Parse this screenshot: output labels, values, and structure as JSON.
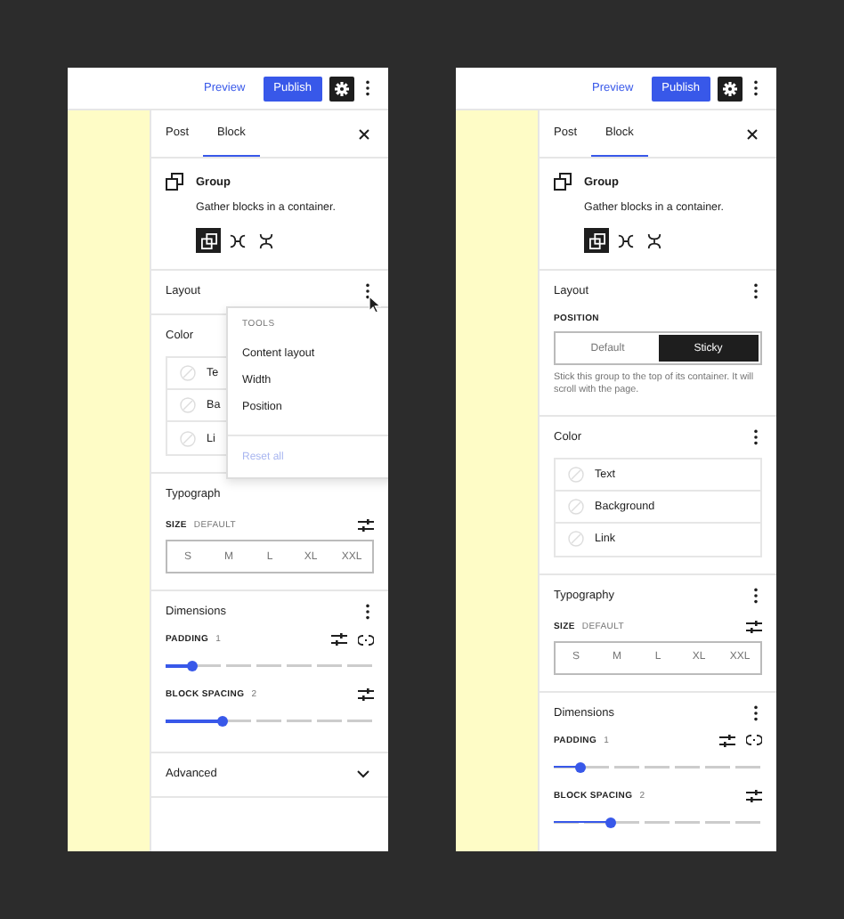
{
  "panels": [
    {
      "topbar": {
        "preview": "Preview",
        "publish": "Publish"
      },
      "tabs": [
        {
          "label": "Post",
          "selected": false
        },
        {
          "label": "Block",
          "selected": true
        }
      ],
      "block": {
        "title": "Group",
        "description": "Gather blocks in a container.",
        "variations": [
          {
            "kind": "group",
            "selected": true
          },
          {
            "kind": "row",
            "selected": false
          },
          {
            "kind": "stack",
            "selected": false
          }
        ]
      },
      "sections": [
        {
          "kind": "layout",
          "title": "Layout",
          "options_button": true,
          "menu": {
            "heading": "TOOLS",
            "items": [
              "Content layout",
              "Width",
              "Position"
            ],
            "reset": "Reset all"
          }
        },
        {
          "kind": "color",
          "title": "Color",
          "items": [
            "Te",
            "Ba",
            "Li"
          ]
        },
        {
          "kind": "typography",
          "title": "Typograph",
          "size_label": "SIZE",
          "size_value": "DEFAULT",
          "sizes": [
            {
              "label": "S",
              "selected": false
            },
            {
              "label": "M",
              "selected": false
            },
            {
              "label": "L",
              "selected": false
            },
            {
              "label": "XL",
              "selected": false
            },
            {
              "label": "XXL",
              "selected": false
            }
          ]
        },
        {
          "kind": "dimensions",
          "title": "Dimensions",
          "options_button": true,
          "controls": [
            {
              "label": "PADDING",
              "value": "1",
              "link_button": true,
              "level": 0.13
            },
            {
              "label": "BLOCK SPACING",
              "value": "2",
              "link_button": false,
              "level": 0.27
            }
          ]
        },
        {
          "kind": "advanced",
          "title": "Advanced",
          "expanded": false
        }
      ]
    },
    {
      "topbar": {
        "preview": "Preview",
        "publish": "Publish"
      },
      "tabs": [
        {
          "label": "Post",
          "selected": false
        },
        {
          "label": "Block",
          "selected": true
        }
      ],
      "block": {
        "title": "Group",
        "description": "Gather blocks in a container.",
        "variations": [
          {
            "kind": "group",
            "selected": true
          },
          {
            "kind": "row",
            "selected": false
          },
          {
            "kind": "stack",
            "selected": false
          }
        ]
      },
      "sections": [
        {
          "kind": "layout",
          "title": "Layout",
          "options_button": true,
          "position": {
            "label": "POSITION",
            "options": [
              {
                "label": "Default",
                "selected": false
              },
              {
                "label": "Sticky",
                "selected": true
              }
            ],
            "help": "Stick this group to the top of its container. It will scroll with the page."
          }
        },
        {
          "kind": "color",
          "title": "Color",
          "options_button": true,
          "items": [
            "Text",
            "Background",
            "Link"
          ]
        },
        {
          "kind": "typography",
          "title": "Typography",
          "options_button": true,
          "size_label": "SIZE",
          "size_value": "DEFAULT",
          "sizes": [
            {
              "label": "S",
              "selected": false
            },
            {
              "label": "M",
              "selected": false
            },
            {
              "label": "L",
              "selected": false
            },
            {
              "label": "XL",
              "selected": false
            },
            {
              "label": "XXL",
              "selected": false
            }
          ]
        },
        {
          "kind": "dimensions",
          "title": "Dimensions",
          "options_button": true,
          "controls": [
            {
              "label": "PADDING",
              "value": "1",
              "link_button": true,
              "level": 0.13
            },
            {
              "label": "BLOCK SPACING",
              "value": "2",
              "link_button": false,
              "level": 0.27
            }
          ]
        }
      ]
    }
  ]
}
